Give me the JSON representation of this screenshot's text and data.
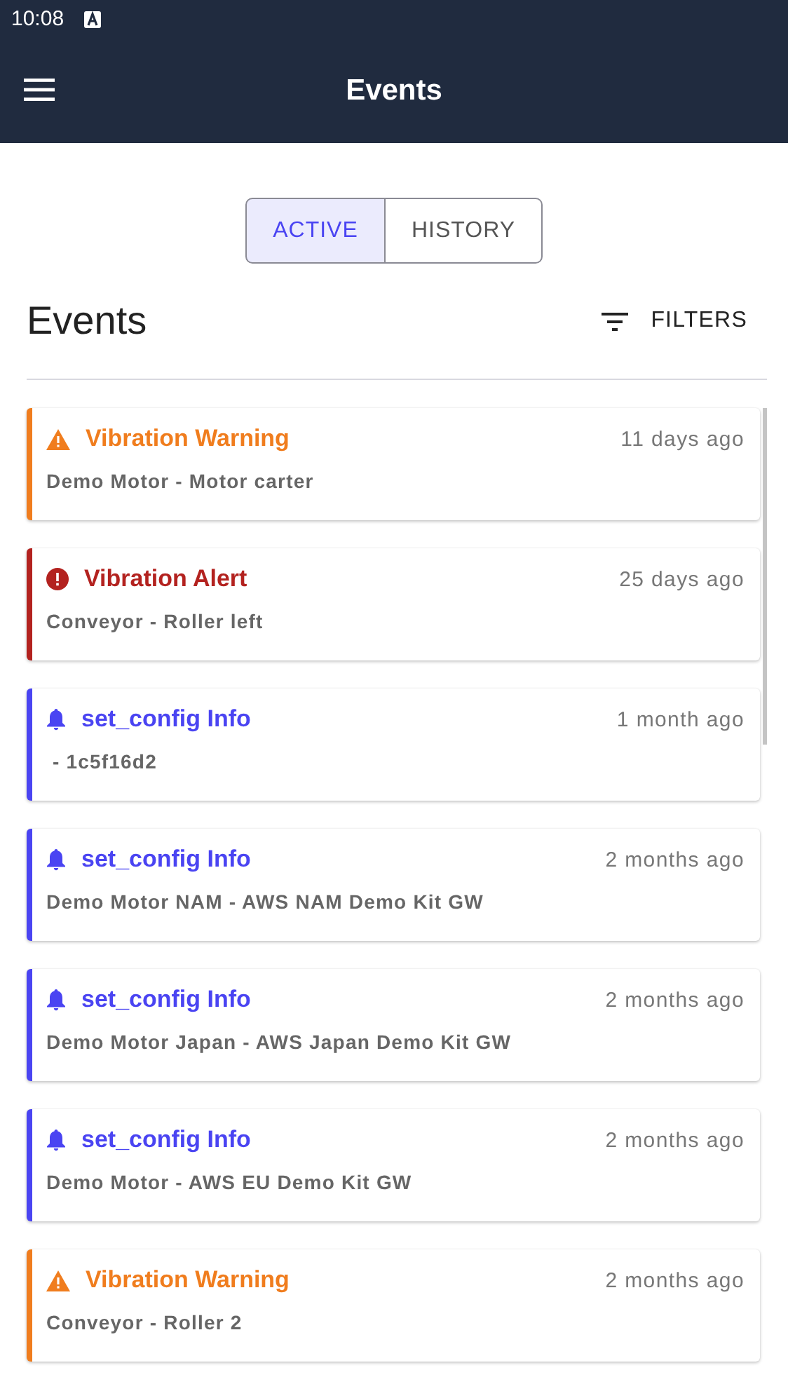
{
  "status_bar": {
    "time": "10:08"
  },
  "app_bar": {
    "title": "Events"
  },
  "tabs": [
    {
      "label": "ACTIVE",
      "selected": true
    },
    {
      "label": "HISTORY",
      "selected": false
    }
  ],
  "heading": "Events",
  "filters_button": "FILTERS",
  "events": [
    {
      "kind": "warning",
      "title": "Vibration Warning",
      "time": "11 days ago",
      "source": "Demo Motor - Motor carter"
    },
    {
      "kind": "alert",
      "title": "Vibration Alert",
      "time": "25 days ago",
      "source": "Conveyor - Roller left"
    },
    {
      "kind": "info",
      "title": "set_config Info",
      "time": "1 month ago",
      "source": " - 1c5f16d2"
    },
    {
      "kind": "info",
      "title": "set_config Info",
      "time": "2 months ago",
      "source": "Demo Motor NAM - AWS NAM Demo Kit GW"
    },
    {
      "kind": "info",
      "title": "set_config Info",
      "time": "2 months ago",
      "source": "Demo Motor Japan - AWS Japan Demo Kit GW"
    },
    {
      "kind": "info",
      "title": "set_config Info",
      "time": "2 months ago",
      "source": "Demo Motor - AWS EU Demo Kit GW"
    },
    {
      "kind": "warning",
      "title": "Vibration Warning",
      "time": "2 months ago",
      "source": "Conveyor - Roller 2"
    }
  ]
}
